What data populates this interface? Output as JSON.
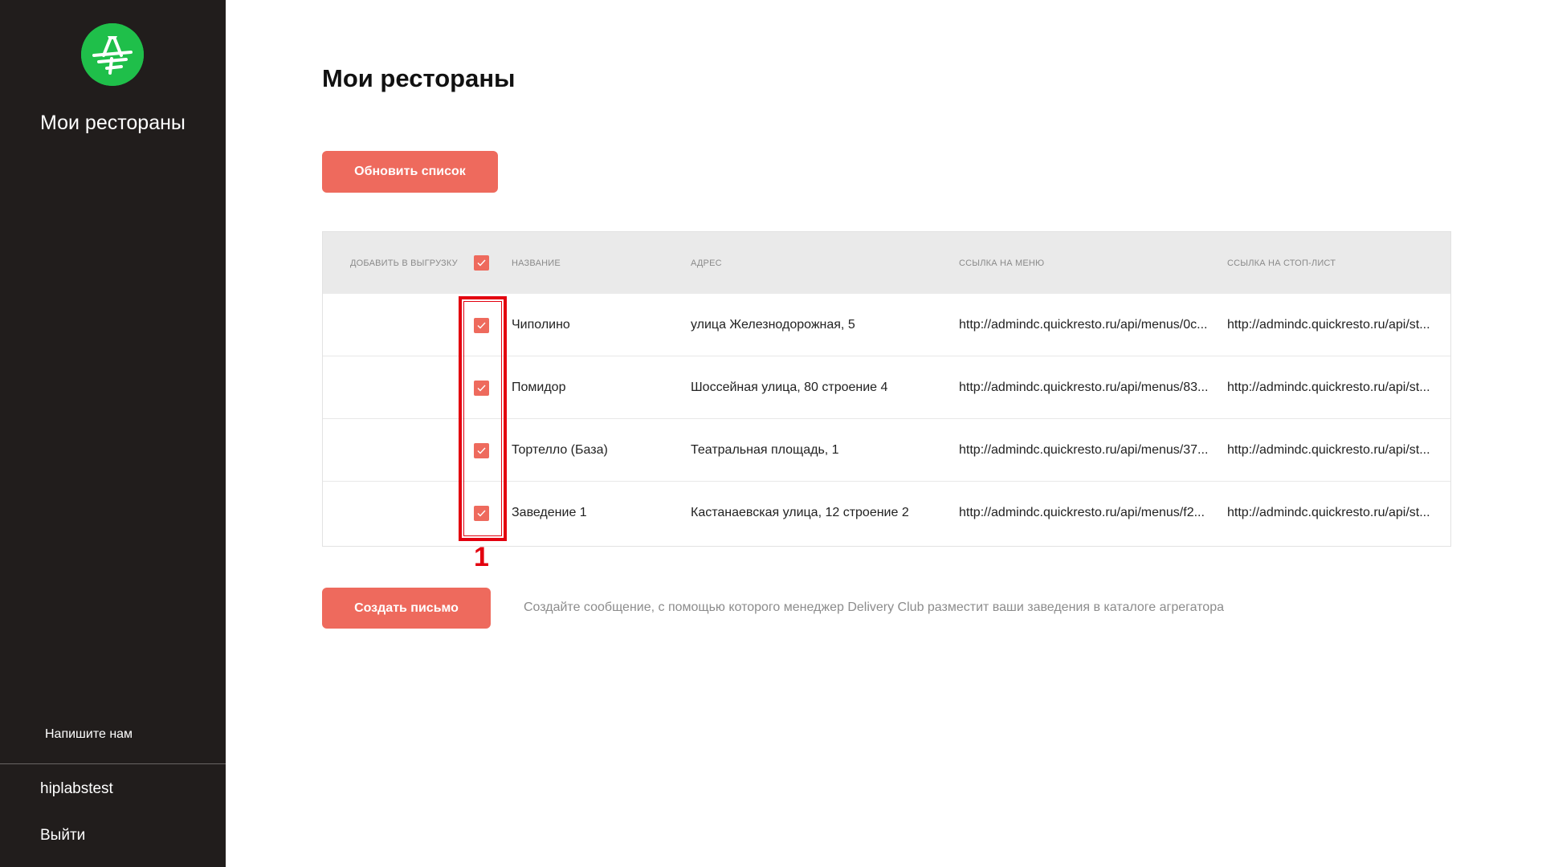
{
  "sidebar": {
    "title": "Мои рестораны",
    "write_us": "Напишите нам",
    "username": "hiplabstest",
    "logout": "Выйти"
  },
  "main": {
    "title": "Мои рестораны",
    "refresh_label": "Обновить список",
    "create_letter_label": "Создать письмо",
    "hint": "Создайте сообщение, с помощью которого менеджер Delivery Club разместит ваши заведения в каталоге агрегатора"
  },
  "table": {
    "headers": {
      "add": "ДОБАВИТЬ В ВЫГРУЗКУ",
      "name": "НАЗВАНИЕ",
      "address": "АДРЕС",
      "menu_link": "ССЫЛКА НА МЕНЮ",
      "stop_link": "ССЫЛКА НА СТОП-ЛИСТ"
    },
    "select_all_checked": true,
    "rows": [
      {
        "checked": true,
        "name": "Чиполино",
        "address": "улица Железнодорожная, 5",
        "menu_link": "http://admindc.quickresto.ru/api/menus/0c...",
        "stop_link": "http://admindc.quickresto.ru/api/st..."
      },
      {
        "checked": true,
        "name": "Помидор",
        "address": "Шоссейная улица, 80 строение 4",
        "menu_link": "http://admindc.quickresto.ru/api/menus/83...",
        "stop_link": "http://admindc.quickresto.ru/api/st..."
      },
      {
        "checked": true,
        "name": "Тортелло (База)",
        "address": "Театральная площадь, 1",
        "menu_link": "http://admindc.quickresto.ru/api/menus/37...",
        "stop_link": "http://admindc.quickresto.ru/api/st..."
      },
      {
        "checked": true,
        "name": "Заведение 1",
        "address": "Кастанаевская улица, 12 строение 2",
        "menu_link": "http://admindc.quickresto.ru/api/menus/f2...",
        "stop_link": "http://admindc.quickresto.ru/api/st..."
      }
    ]
  },
  "annotation": {
    "label": "1",
    "color": "#e3000f"
  },
  "colors": {
    "accent": "#ee6a5d",
    "sidebar_bg": "#211d1c",
    "logo_green": "#1fbf4a"
  }
}
